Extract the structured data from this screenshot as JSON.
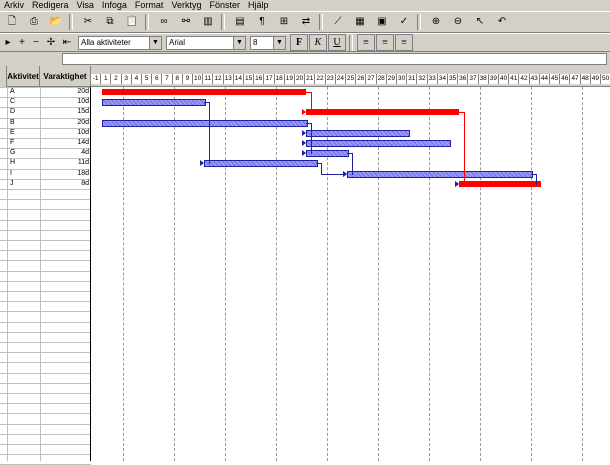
{
  "menu": [
    "Arkiv",
    "Redigera",
    "Visa",
    "Infoga",
    "Format",
    "Verktyg",
    "Fönster",
    "Hjälp"
  ],
  "toolbar2": {
    "filter_value": "Alla aktiviteter",
    "font_value": "Arial",
    "size_value": "8",
    "bold_label": "F",
    "italic_label": "K",
    "underline_label": "U"
  },
  "table": {
    "columns": [
      "Aktivitet",
      "Varaktighet"
    ],
    "rows": [
      {
        "activity": "A",
        "duration": "20d"
      },
      {
        "activity": "C",
        "duration": "10d"
      },
      {
        "activity": "D",
        "duration": "15d"
      },
      {
        "activity": "B",
        "duration": "20d"
      },
      {
        "activity": "E",
        "duration": "10d"
      },
      {
        "activity": "F",
        "duration": "14d"
      },
      {
        "activity": "G",
        "duration": "4d"
      },
      {
        "activity": "H",
        "duration": "11d"
      },
      {
        "activity": "I",
        "duration": "18d"
      },
      {
        "activity": "J",
        "duration": "8d"
      }
    ]
  },
  "timeline": {
    "days": [
      "-1",
      "1",
      "2",
      "3",
      "4",
      "5",
      "6",
      "7",
      "8",
      "9",
      "10",
      "11",
      "12",
      "13",
      "14",
      "15",
      "16",
      "17",
      "18",
      "19",
      "20",
      "21",
      "22",
      "23",
      "24",
      "25",
      "26",
      "27",
      "28",
      "29",
      "30",
      "31",
      "32",
      "33",
      "34",
      "35",
      "36",
      "37",
      "38",
      "39",
      "40",
      "41",
      "42",
      "43",
      "44",
      "45",
      "46",
      "47",
      "48",
      "49",
      "50"
    ]
  },
  "gantt": {
    "bars": [
      {
        "task": "A",
        "start": 0,
        "end": 20,
        "critical": true
      },
      {
        "task": "C",
        "start": 0,
        "end": 10,
        "critical": false
      },
      {
        "task": "D",
        "start": 20,
        "end": 35,
        "critical": true
      },
      {
        "task": "B",
        "start": 0,
        "end": 20,
        "critical": false
      },
      {
        "task": "E",
        "start": 20,
        "end": 30,
        "critical": false
      },
      {
        "task": "F",
        "start": 20,
        "end": 34,
        "critical": false
      },
      {
        "task": "G",
        "start": 20,
        "end": 24,
        "critical": false
      },
      {
        "task": "H",
        "start": 10,
        "end": 21,
        "critical": false
      },
      {
        "task": "I",
        "start": 24,
        "end": 42,
        "critical": false
      },
      {
        "task": "J",
        "start": 35,
        "end": 43,
        "critical": true
      }
    ],
    "colors": {
      "critical": "#ff0000",
      "normal": "#8c8cf0",
      "link": "#2020a0"
    }
  }
}
